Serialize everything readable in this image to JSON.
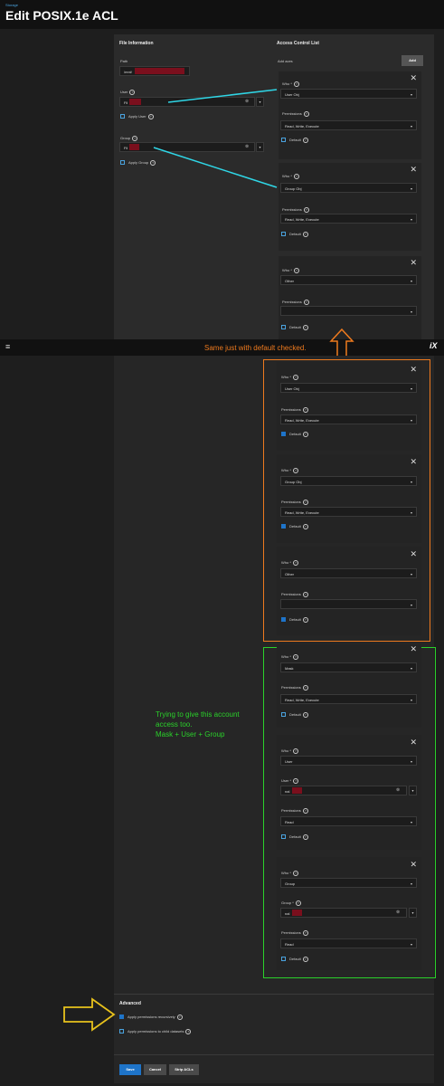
{
  "breadcrumb": "Storage",
  "page_title": "Edit POSIX.1e ACL",
  "file_info": {
    "title": "File Information",
    "path_label": "Path",
    "path_value": "/mnt/",
    "user_label": "User",
    "user_value": "Fil",
    "apply_user": "Apply User",
    "group_label": "Group",
    "group_value": "Fil",
    "apply_group": "Apply Group"
  },
  "acl": {
    "title": "Access Control List",
    "add_aces": "Add aces",
    "add_button": "Add"
  },
  "labels": {
    "who": "Who *",
    "permissions": "Permissions",
    "default": "Default",
    "user_req": "User *",
    "group_req": "Group *"
  },
  "top_entries": [
    {
      "who": "User Obj",
      "perm": "Read, Write, Execute"
    },
    {
      "who": "Group Obj",
      "perm": "Read, Write, Execute"
    },
    {
      "who": "Other",
      "perm": ""
    }
  ],
  "annotations": {
    "orange_note": "Same just with default checked.",
    "green_note_1": "Trying to give this account",
    "green_note_2": "access too.",
    "green_note_3": "Mask + User + Group"
  },
  "default_entries": [
    {
      "who": "User Obj",
      "perm": "Read, Write, Execute"
    },
    {
      "who": "Group Obj",
      "perm": "Read, Write, Execute"
    },
    {
      "who": "Other",
      "perm": ""
    }
  ],
  "extra_entries": [
    {
      "who": "Mask",
      "perm": "Read, Write, Execute"
    },
    {
      "who": "User",
      "name": "nal",
      "perm": "Read"
    },
    {
      "who": "Group",
      "name": "nal",
      "perm": "Read"
    }
  ],
  "advanced": {
    "title": "Advanced",
    "recursive": "Apply permissions recursively",
    "child": "Apply permissions to child datasets"
  },
  "footer": {
    "save": "Save",
    "cancel": "Cancel",
    "strip": "Strip ACLs"
  },
  "colors": {
    "orange": "#ee7a1e",
    "green": "#2ad12a",
    "cyan": "#2fd6e6",
    "accent": "#1e74c9"
  }
}
